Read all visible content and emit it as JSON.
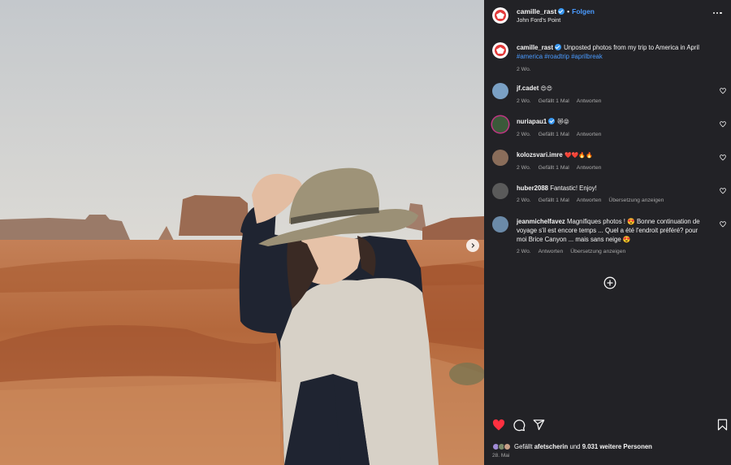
{
  "header": {
    "username": "camille_rast",
    "follow_label": "Folgen",
    "separator": "•",
    "location": "John Ford's Point"
  },
  "caption": {
    "username": "camille_rast",
    "text": "Unposted photos from my trip to America in April",
    "hashtags": [
      "#america",
      "#roadtrip",
      "#aprilbreak"
    ],
    "time": "2 Wo."
  },
  "comments": [
    {
      "username": "jf.cadet",
      "text": "😍😍",
      "time": "2 Wo.",
      "likes": "Gefällt 1 Mal",
      "reply": "Antworten",
      "translate": "",
      "avatar_color": "#7aa0c4"
    },
    {
      "username": "nuriapau1",
      "verified": true,
      "text": "😻😝",
      "time": "2 Wo.",
      "likes": "Gefällt 1 Mal",
      "reply": "Antworten",
      "translate": "",
      "avatar_color": "#3b5a3a"
    },
    {
      "username": "kolozsvari.imre",
      "text": "❤️❤️🔥🔥",
      "time": "2 Wo.",
      "likes": "Gefällt 1 Mal",
      "reply": "Antworten",
      "translate": "",
      "avatar_color": "#8a6d5a"
    },
    {
      "username": "huber2088",
      "text": "Fantastic! Enjoy!",
      "time": "2 Wo.",
      "likes": "Gefällt 1 Mal",
      "reply": "Antworten",
      "translate": "Übersetzung anzeigen",
      "avatar_color": "#5a5a5a"
    },
    {
      "username": "jeanmichelfavez",
      "text": "Magnifiques photos ! 😍 Bonne continuation de voyage s'il est encore temps ... Quel a été l'endroit préféré? pour moi Brice Canyon ... mais sans neige 😍",
      "time": "2 Wo.",
      "likes": "",
      "reply": "Antworten",
      "translate": "Übersetzung anzeigen",
      "avatar_color": "#6b8aa8"
    }
  ],
  "actions": {
    "like_icon": "heart-filled-icon",
    "comment_icon": "comment-icon",
    "share_icon": "share-icon",
    "save_icon": "bookmark-icon"
  },
  "likes": {
    "prefix": "Gefällt",
    "user": "afetscherin",
    "middle": "und",
    "count": "9.031 weitere Personen"
  },
  "date": "28. Mai",
  "colors": {
    "accent": "#4a9bff",
    "like": "#ff3040",
    "panel_bg": "#222226"
  }
}
